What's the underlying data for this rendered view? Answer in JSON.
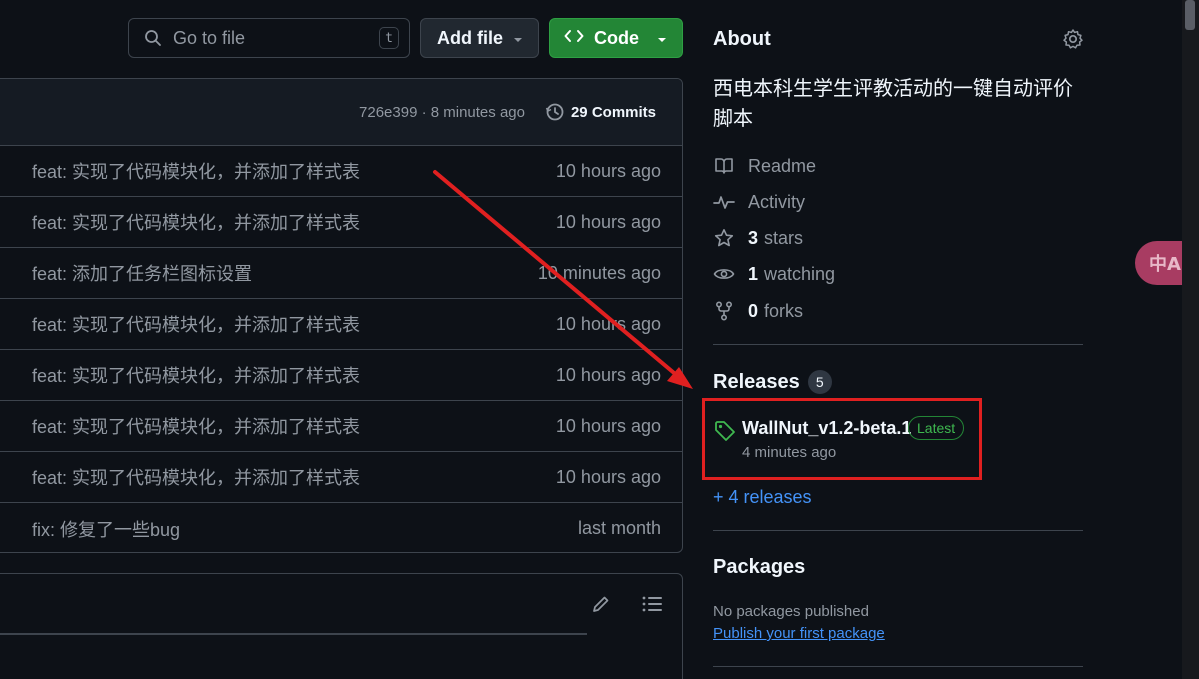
{
  "toolbar": {
    "search_placeholder": "Go to file",
    "search_shortcut": "t",
    "add_file_label": "Add file",
    "code_label": "Code"
  },
  "latest_commit": {
    "hash_time": "726e399 · 8 minutes ago",
    "commits_label": "29 Commits"
  },
  "files": [
    {
      "message": "feat: 实现了代码模块化，并添加了样式表",
      "time": "10 hours ago"
    },
    {
      "message": "feat: 实现了代码模块化，并添加了样式表",
      "time": "10 hours ago"
    },
    {
      "message": "feat: 添加了任务栏图标设置",
      "time": "10 minutes ago"
    },
    {
      "message": "feat: 实现了代码模块化，并添加了样式表",
      "time": "10 hours ago"
    },
    {
      "message": "feat: 实现了代码模块化，并添加了样式表",
      "time": "10 hours ago"
    },
    {
      "message": "feat: 实现了代码模块化，并添加了样式表",
      "time": "10 hours ago"
    },
    {
      "message": "feat: 实现了代码模块化，并添加了样式表",
      "time": "10 hours ago"
    },
    {
      "message": "fix: 修复了一些bug",
      "time": "last month"
    }
  ],
  "about": {
    "title": "About",
    "description": "西电本科生学生评教活动的一键自动评价脚本",
    "readme": "Readme",
    "activity": "Activity",
    "stars_count": "3",
    "stars_label": "stars",
    "watching_count": "1",
    "watching_label": "watching",
    "forks_count": "0",
    "forks_label": "forks"
  },
  "releases": {
    "title": "Releases",
    "count": "5",
    "latest_name": "WallNut_v1.2-beta.1",
    "latest_badge": "Latest",
    "latest_time": "4 minutes ago",
    "more_link": "+ 4 releases"
  },
  "packages": {
    "title": "Packages",
    "none_text": "No packages published",
    "publish_link": "Publish your first package"
  },
  "translate_bubble": "中A",
  "colors": {
    "background": "#0d1117",
    "border": "#3d444d",
    "accent_green": "#238636",
    "link_blue": "#4493f8",
    "annotation_red": "#e02020"
  }
}
